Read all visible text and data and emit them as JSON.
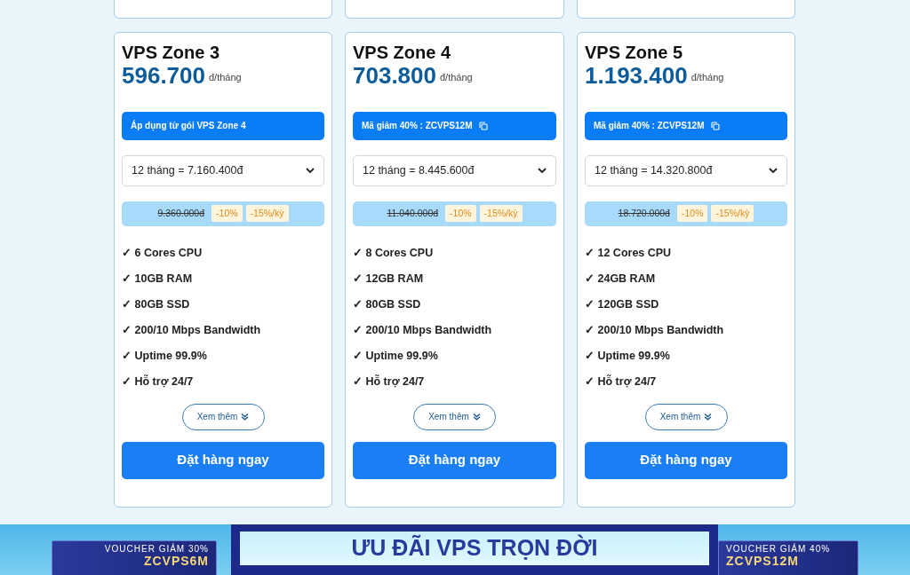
{
  "plans": [
    {
      "name": "VPS Zone 3",
      "price": "596.700",
      "unit": "đ/tháng",
      "promo": {
        "kind": "note",
        "text": "Áp dụng từ gói VPS Zone 4"
      },
      "term": "12 tháng = 7.160.400đ",
      "old_price": "9.360.000đ",
      "badges": [
        "-10%",
        "-15%/kỳ"
      ],
      "features": [
        "6 Cores CPU",
        "10GB RAM",
        "80GB SSD",
        "200/10 Mbps Bandwidth",
        "Uptime 99.9%",
        "Hỗ trợ 24/7"
      ],
      "check": "✓",
      "more": "Xem thêm",
      "order": "Đặt hàng ngay"
    },
    {
      "name": "VPS Zone 4",
      "price": "703.800",
      "unit": "đ/tháng",
      "promo": {
        "kind": "code",
        "text": "Mã giảm 40% : ZCVPS12M"
      },
      "term": "12 tháng = 8.445.600đ",
      "old_price": "11.040.000đ",
      "badges": [
        "-10%",
        "-15%/kỳ"
      ],
      "features": [
        "8 Cores CPU",
        "12GB RAM",
        "80GB SSD",
        "200/10 Mbps Bandwidth",
        "Uptime 99.9%",
        "Hỗ trợ 24/7"
      ],
      "check": "✓",
      "more": "Xem thêm",
      "order": "Đặt hàng ngay"
    },
    {
      "name": "VPS Zone 5",
      "price": "1.193.400",
      "unit": "đ/tháng",
      "promo": {
        "kind": "code",
        "text": "Mã giảm 40% : ZCVPS12M"
      },
      "term": "12 tháng = 14.320.800đ",
      "old_price": "18.720.000đ",
      "badges": [
        "-10%",
        "-15%/kỳ"
      ],
      "features": [
        "12 Cores CPU",
        "24GB RAM",
        "120GB SSD",
        "200/10 Mbps Bandwidth",
        "Uptime 99.9%",
        "Hỗ trợ 24/7"
      ],
      "check": "✓",
      "more": "Xem thêm",
      "order": "Đặt hàng ngay"
    }
  ],
  "banner": {
    "voucher_left": {
      "label": "VOUCHER GIẢM 30%",
      "code": "ZCVPS6M"
    },
    "title": "ƯU ĐÃI VPS TRỌN ĐỜI",
    "voucher_right": {
      "label": "VOUCHER GIẢM 40%",
      "code": "ZCVPS12M"
    }
  }
}
